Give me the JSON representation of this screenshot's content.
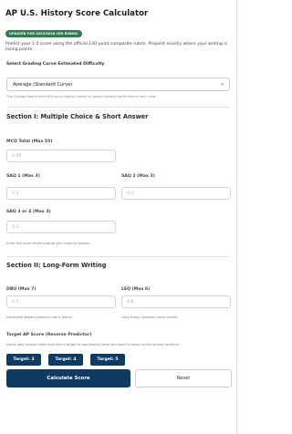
{
  "header": {
    "title": "AP U.S. History Score Calculator",
    "badge": "UPDATED FOR 2025/2026 CED RUBRIC",
    "description": "Predict your 1-5 score using the official 130-point composite rubric. Pinpoint exactly where your writing is losing points."
  },
  "curve": {
    "label": "Select Grading Curve Estimated Difficulty",
    "selected": "Average (Standard Curve)",
    "note": "The College Board shifts the curve slightly based on global student performance each year."
  },
  "section1": {
    "title": "Section I: Multiple Choice & Short Answer",
    "mcq": {
      "label": "MCQ Total (Max 55)",
      "placeholder": "0-55"
    },
    "saq1": {
      "label": "SAQ 1 (Max 3)",
      "placeholder": "0-3"
    },
    "saq2": {
      "label": "SAQ 2 (Max 3)",
      "placeholder": "0-3"
    },
    "saq34": {
      "label": "SAQ 3 or 4 (Max 3)",
      "placeholder": "0-3",
      "hint": "Enter the score of the prompt you chose to answer."
    }
  },
  "section2": {
    "title": "Section II: Long-Form Writing",
    "dbq": {
      "label": "DBQ (Max 7)",
      "placeholder": "0-7",
      "hint": "Document-Based Question rubric points."
    },
    "leq": {
      "label": "LEQ (Max 6)",
      "placeholder": "0-6",
      "hint": "Long Essay Question rubric points."
    }
  },
  "target": {
    "label": "Target AP Score (Reverse Predictor)",
    "note": "Leave your essays blank and click a target to see exactly what you need to score on the writing sections!",
    "buttons": [
      "Target: 3",
      "Target: 4",
      "Target: 5"
    ]
  },
  "actions": {
    "calculate": "Calculate Score",
    "reset": "Reset"
  },
  "colors": {
    "primary": "#0f3a64",
    "badge_green": "#2e7d4f"
  }
}
